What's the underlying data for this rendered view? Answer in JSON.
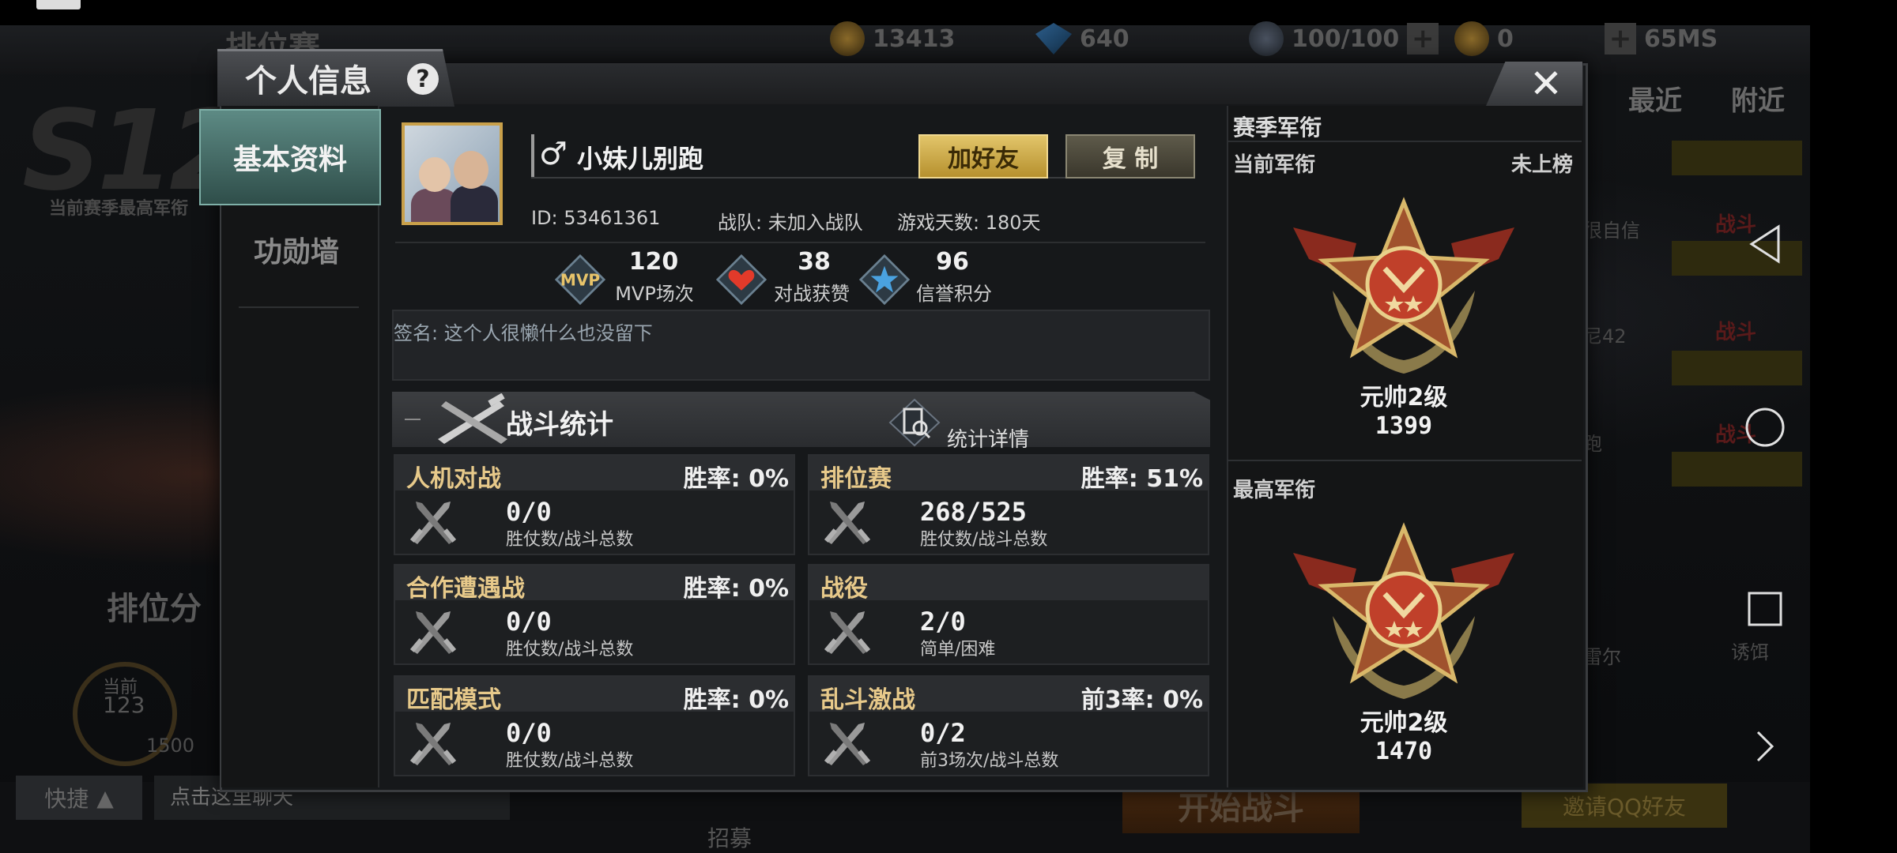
{
  "header": {
    "title": "个人信息",
    "help": "?",
    "close": "✕"
  },
  "background": {
    "mode_title": "排位赛",
    "season": "S12",
    "season_sub": "当前赛季最高军衔",
    "rank_label": "排位分",
    "current_label": "当前",
    "current_value": "123",
    "max_value": "1500",
    "resources": [
      "13413",
      "640",
      "100/100",
      "0"
    ],
    "resources_extra": "65MS",
    "right_tabs": [
      "最近",
      "附近"
    ],
    "right_texts": [
      "很自信",
      "尼42",
      "跑",
      "雷尔",
      "诱饵"
    ],
    "right_red": [
      "战斗",
      "战斗",
      "战斗"
    ],
    "quick_label": "快捷",
    "chat_placeholder": "点击这里聊天",
    "start_label": "开始战斗",
    "invite_label": "邀请QQ好友",
    "recruit_label": "招募"
  },
  "tabs": {
    "basic": "基本资料",
    "merit": "功勋墙"
  },
  "profile": {
    "gender_icon": "♂",
    "name": "小妹儿别跑",
    "add_friend": "加好友",
    "copy": "复 制",
    "id": "ID: 53461361",
    "team": "战队: 未加入战队",
    "days": "游戏天数: 180天",
    "signature": "签名: 这个人很懒什么也没留下"
  },
  "badges": [
    {
      "icon": "MVP",
      "value": "120",
      "label": "MVP场次"
    },
    {
      "icon": "heart",
      "value": "38",
      "label": "对战获赞"
    },
    {
      "icon": "star",
      "value": "96",
      "label": "信誉积分"
    }
  ],
  "battle": {
    "title": "战斗统计",
    "detail": "统计详情"
  },
  "modes": [
    {
      "name": "人机对战",
      "rate": "胜率: 0%",
      "value": "0/0",
      "sub": "胜仗数/战斗总数"
    },
    {
      "name": "排位赛",
      "rate": "胜率: 51%",
      "value": "268/525",
      "sub": "胜仗数/战斗总数"
    },
    {
      "name": "合作遭遇战",
      "rate": "胜率: 0%",
      "value": "0/0",
      "sub": "胜仗数/战斗总数"
    },
    {
      "name": "战役",
      "rate": "",
      "value": "2/0",
      "sub": "简单/困难"
    },
    {
      "name": "匹配模式",
      "rate": "胜率: 0%",
      "value": "0/0",
      "sub": "胜仗数/战斗总数"
    },
    {
      "name": "乱斗激战",
      "rate": "前3率: 0%",
      "value": "0/2",
      "sub": "前3场次/战斗总数"
    }
  ],
  "rank": {
    "section_title": "赛季军衔",
    "current_label": "当前军衔",
    "current_status": "未上榜",
    "current_name": "元帅2级",
    "current_score": "1399",
    "best_label": "最高军衔",
    "best_name": "元帅2级",
    "best_score": "1470"
  },
  "colors": {
    "gold_button": "#e2c56a",
    "tab_active": "#5d8a84",
    "mode_name": "#e7c98a",
    "medal_red": "#c0402a"
  }
}
